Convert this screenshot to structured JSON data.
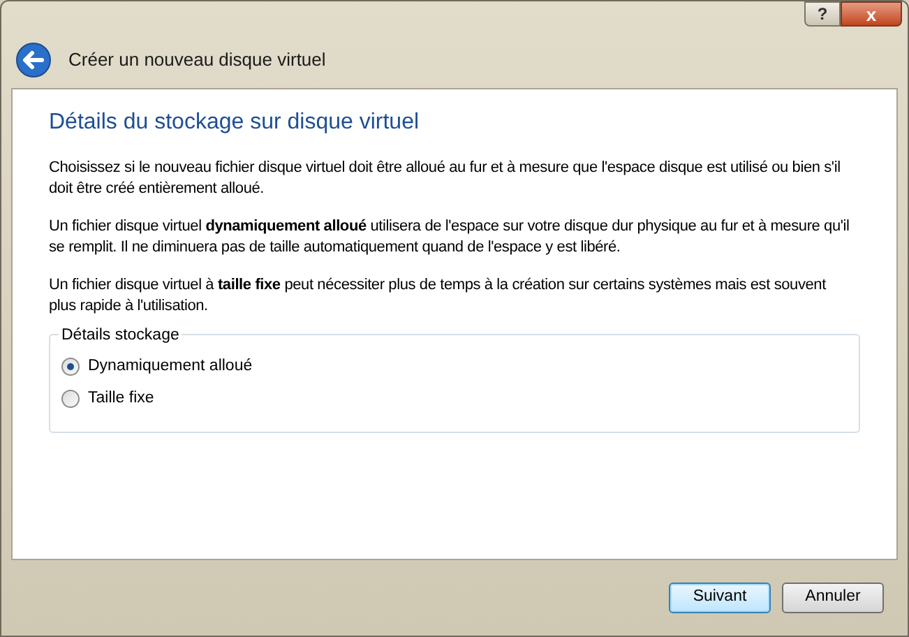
{
  "window": {
    "title": "Créer un nouveau disque virtuel"
  },
  "heading": "Détails du stockage sur disque virtuel",
  "paragraphs": [
    "Choisissez si le nouveau fichier disque virtuel doit être alloué au fur et à mesure que l'espace disque est utilisé ou bien s'il doit être créé entièrement alloué.",
    "Un fichier disque virtuel **dynamiquement alloué** utilisera de l'espace sur votre disque dur physique au fur et à mesure qu'il se remplit. Il ne diminuera pas de taille automatiquement quand de l'espace y est libéré.",
    "Un fichier disque virtuel à **taille fixe** peut nécessiter plus de temps à la création sur certains systèmes mais est souvent plus rapide à l'utilisation."
  ],
  "group": {
    "title": "Détails stockage",
    "options": [
      {
        "label": "Dynamiquement alloué",
        "selected": true
      },
      {
        "label": "Taille fixe",
        "selected": false
      }
    ]
  },
  "buttons": [
    {
      "label": "Suivant",
      "default": true
    },
    {
      "label": "Annuler",
      "default": false
    }
  ],
  "title_buttons": [
    "?",
    "x"
  ]
}
